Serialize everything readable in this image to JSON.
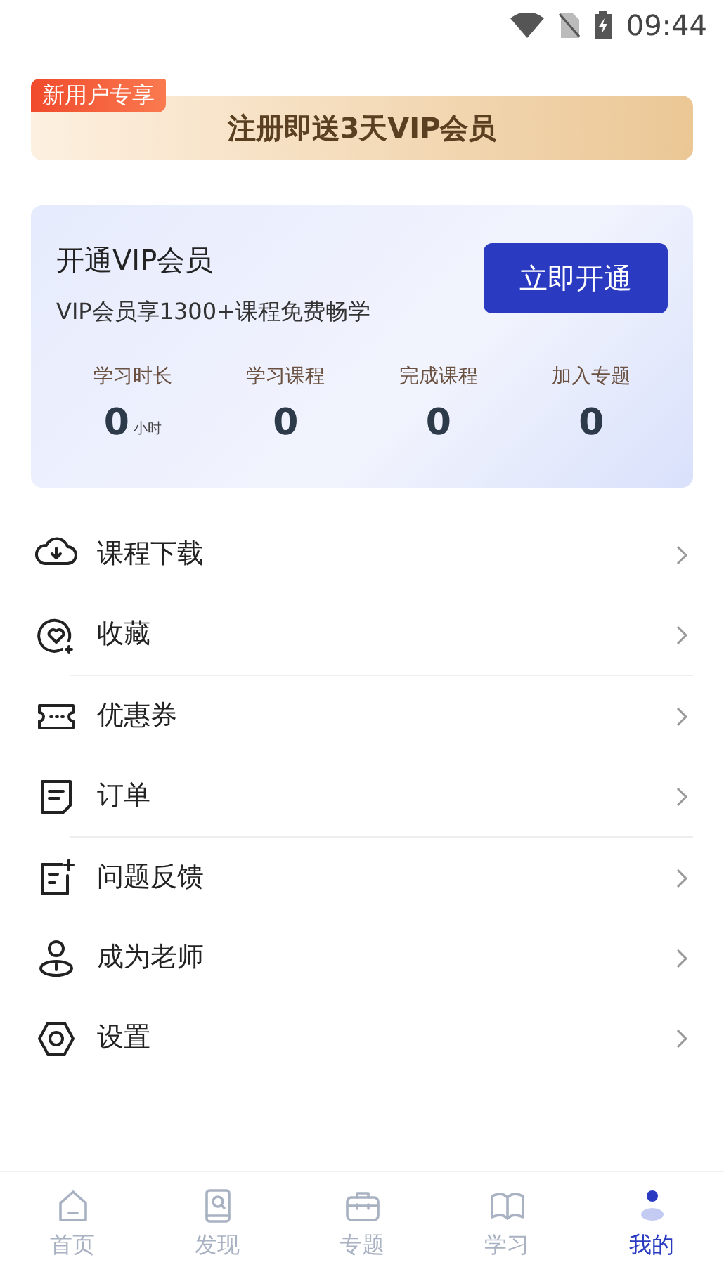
{
  "status_bar": {
    "time": "09:44"
  },
  "promo_banner": {
    "tag": "新用户专享",
    "text": "注册即送3天VIP会员"
  },
  "vip_card": {
    "title": "开通VIP会员",
    "subtitle": "VIP会员享1300+课程免费畅学",
    "button": "立即开通",
    "stats": [
      {
        "label": "学习时长",
        "value": "0",
        "unit": "小时"
      },
      {
        "label": "学习课程",
        "value": "0"
      },
      {
        "label": "完成课程",
        "value": "0"
      },
      {
        "label": "加入专题",
        "value": "0"
      }
    ]
  },
  "menu_groups": [
    [
      {
        "label": "课程下载"
      },
      {
        "label": "收藏"
      }
    ],
    [
      {
        "label": "优惠券"
      },
      {
        "label": "订单"
      }
    ],
    [
      {
        "label": "问题反馈"
      },
      {
        "label": "成为老师"
      },
      {
        "label": "设置"
      }
    ]
  ],
  "bottom_nav": [
    {
      "label": "首页",
      "selected": false
    },
    {
      "label": "发现",
      "selected": false
    },
    {
      "label": "专题",
      "selected": false
    },
    {
      "label": "学习",
      "selected": false
    },
    {
      "label": "我的",
      "selected": true
    }
  ]
}
